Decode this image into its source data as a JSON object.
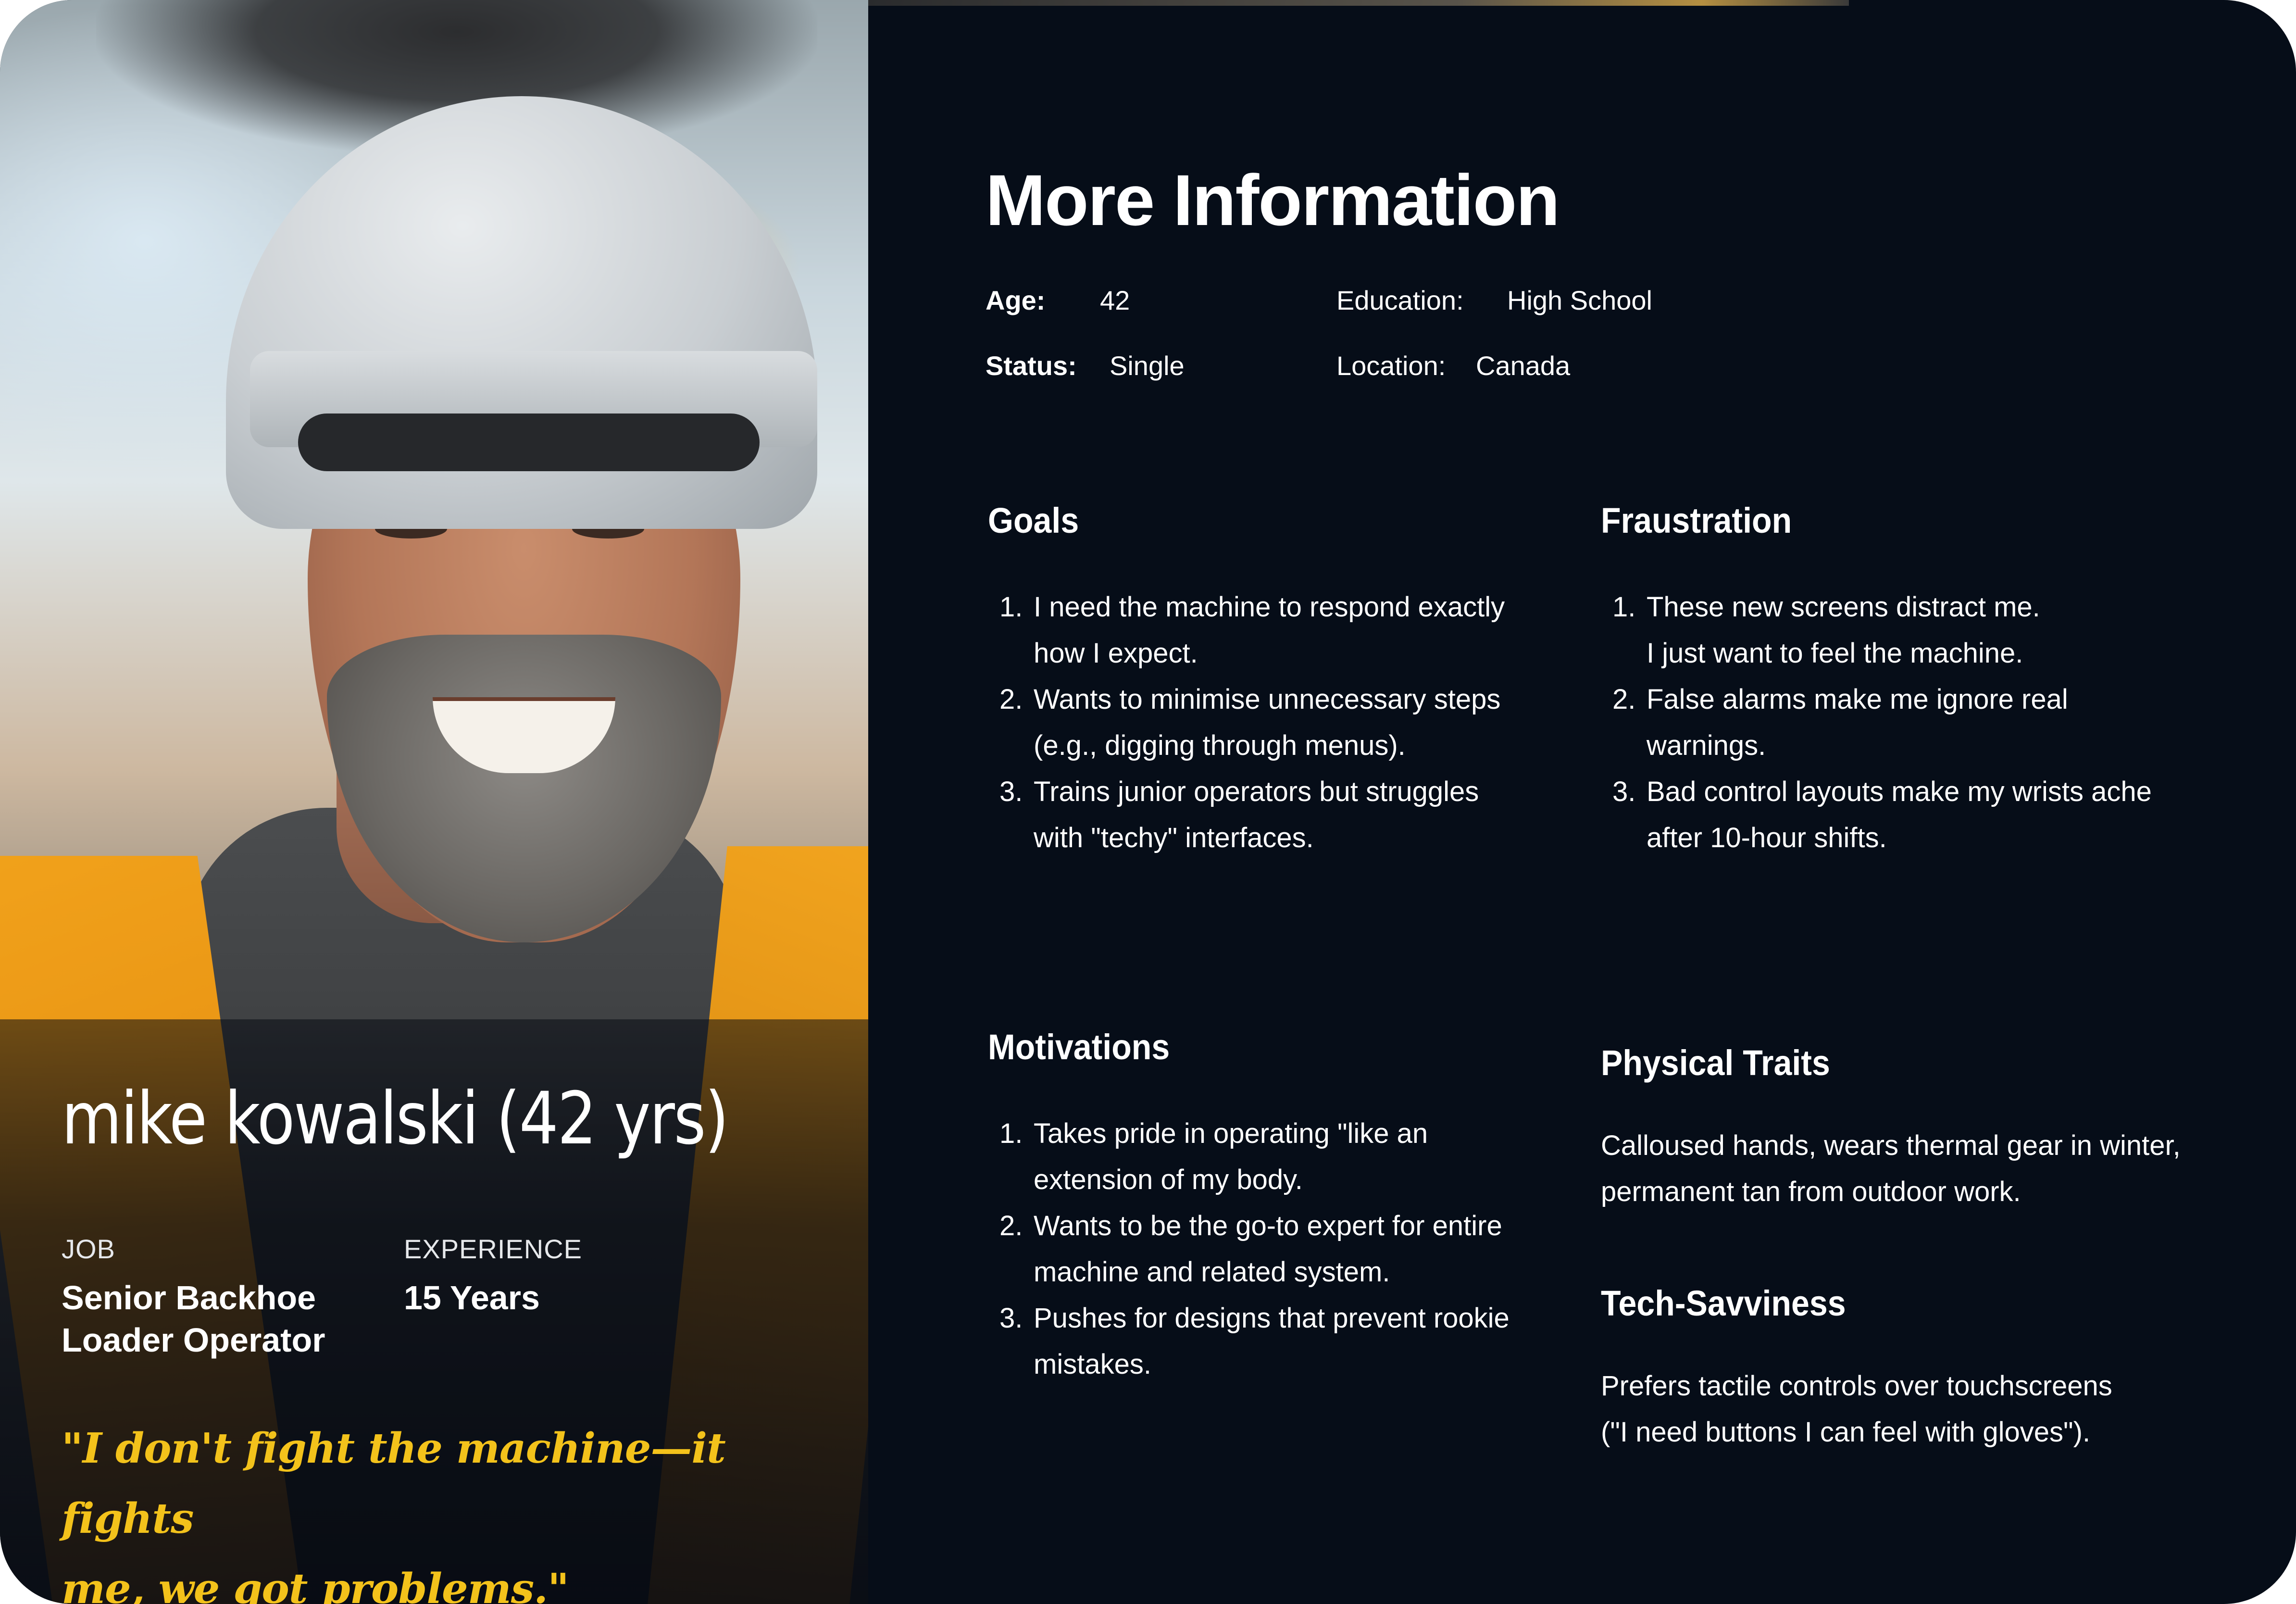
{
  "persona": {
    "name": "mike kowalski (42 yrs)",
    "job_label": "JOB",
    "job_value_line1": "Senior Backhoe",
    "job_value_line2": "Loader Operator",
    "experience_label": "EXPERIENCE",
    "experience_value": "15 Years",
    "quote_line1": "\"I don't fight the machine—it fights",
    "quote_line2": "me, we got problems.\""
  },
  "info": {
    "title": "More Information",
    "age_label": "Age:",
    "age_value": "42",
    "education_label": "Education:",
    "education_value": "High School",
    "status_label": "Status:",
    "status_value": "Single",
    "location_label": "Location:",
    "location_value": "Canada"
  },
  "goals": {
    "title": "Goals",
    "items": [
      {
        "num": "1.",
        "line1": "I need the machine to respond exactly",
        "line2": "how I expect."
      },
      {
        "num": "2.",
        "line1": "Wants to minimise unnecessary steps",
        "line2": "(e.g., digging through menus)."
      },
      {
        "num": "3.",
        "line1": "Trains junior operators but struggles",
        "line2": "with \"techy\" interfaces."
      }
    ]
  },
  "frustration": {
    "title": "Fraustration",
    "items": [
      {
        "num": "1.",
        "line1": "These new screens distract me.",
        "line2": "I just want to feel the machine."
      },
      {
        "num": "2.",
        "line1": "False alarms make me ignore real",
        "line2": "warnings."
      },
      {
        "num": "3.",
        "line1": "Bad control layouts make my wrists ache",
        "line2": "after 10-hour shifts."
      }
    ]
  },
  "motivations": {
    "title": "Motivations",
    "items": [
      {
        "num": "1.",
        "line1": "Takes pride in operating \"like an",
        "line2": "extension of my body."
      },
      {
        "num": "2.",
        "line1": "Wants to be the go-to expert for entire",
        "line2": "machine and related system."
      },
      {
        "num": "3.",
        "line1": "Pushes for designs that prevent rookie",
        "line2": "mistakes."
      }
    ]
  },
  "physical_traits": {
    "title": "Physical Traits",
    "line1": "Calloused hands, wears thermal gear in winter,",
    "line2": "permanent tan from outdoor work."
  },
  "tech_savviness": {
    "title": "Tech-Savviness",
    "line1": "Prefers tactile controls over touchscreens",
    "line2": "(\"I need buttons I can feel with gloves\")."
  },
  "colors": {
    "background": "#060d18",
    "quote": "#f3c21b",
    "text": "#ffffff"
  }
}
